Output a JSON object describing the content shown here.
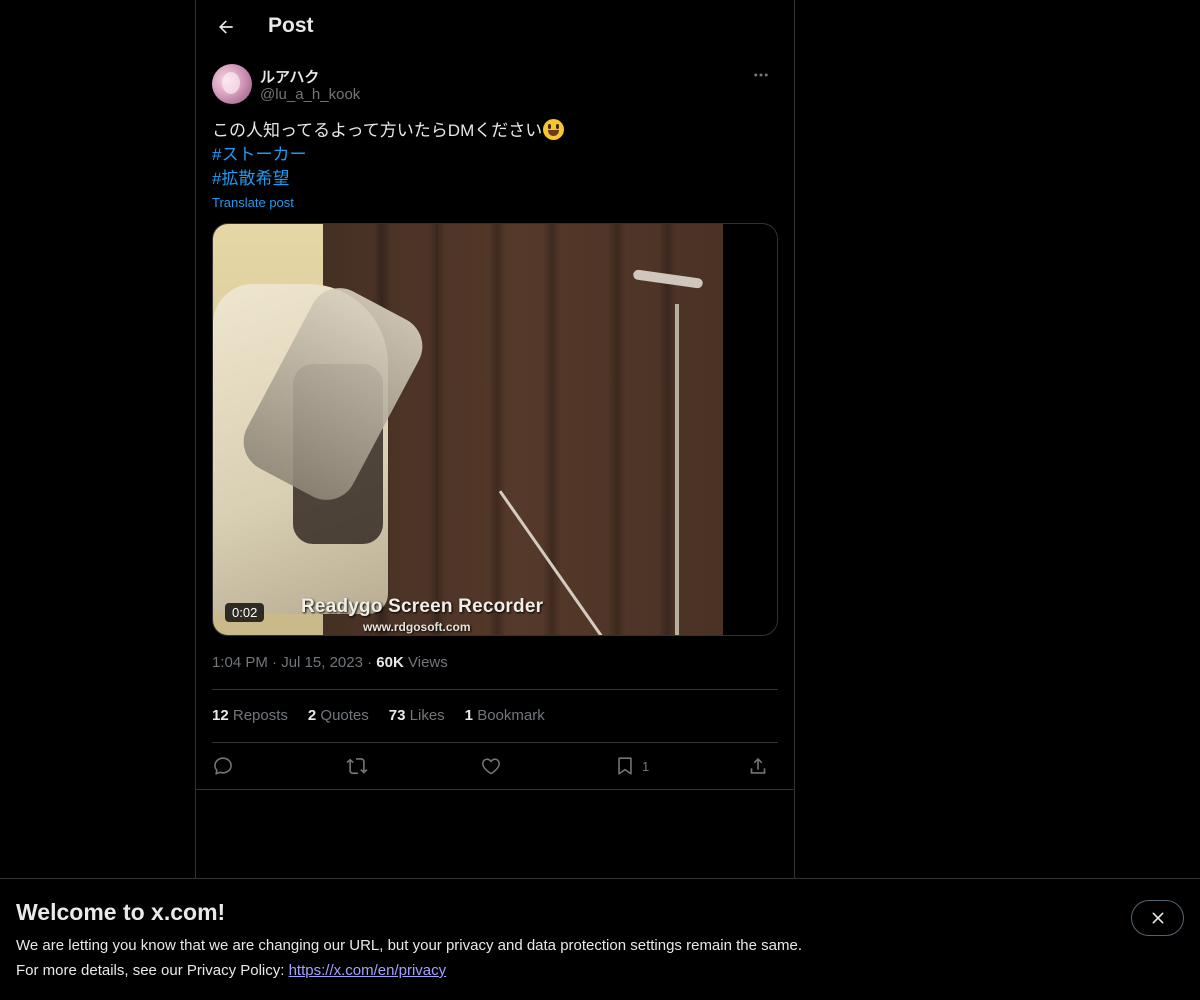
{
  "header": {
    "title": "Post"
  },
  "author": {
    "display_name": "ルアハク",
    "handle": "@lu_a_h_kook"
  },
  "post": {
    "text": "この人知ってるよって方いたらDMください",
    "hashtags": [
      "#ストーカー",
      "#拡散希望"
    ],
    "translate_label": "Translate post"
  },
  "media": {
    "duration": "0:02",
    "watermark": "Readygo Screen Recorder",
    "watermark_url": "www.rdgosoft.com"
  },
  "meta": {
    "time": "1:04 PM",
    "separator": "·",
    "date": "Jul 15, 2023",
    "views_count": "60K",
    "views_label": "Views"
  },
  "stats": [
    {
      "count": "12",
      "label": "Reposts"
    },
    {
      "count": "2",
      "label": "Quotes"
    },
    {
      "count": "73",
      "label": "Likes"
    },
    {
      "count": "1",
      "label": "Bookmark"
    }
  ],
  "actions": {
    "reply_icon": "reply-icon",
    "repost_icon": "repost-icon",
    "like_icon": "heart-icon",
    "bookmark_icon": "bookmark-icon",
    "bookmark_count": "1",
    "share_icon": "share-icon"
  },
  "banner": {
    "title": "Welcome to x.com!",
    "line1": "We are letting you know that we are changing our URL, but your privacy and data protection settings remain the same.",
    "line2_prefix": "For more details, see our Privacy Policy: ",
    "link": "https://x.com/en/privacy"
  },
  "colors": {
    "accent": "#1d9bf0",
    "muted": "#71767b",
    "text": "#e7e9ea",
    "border": "#2f3336",
    "link": "#a6a0ff"
  }
}
